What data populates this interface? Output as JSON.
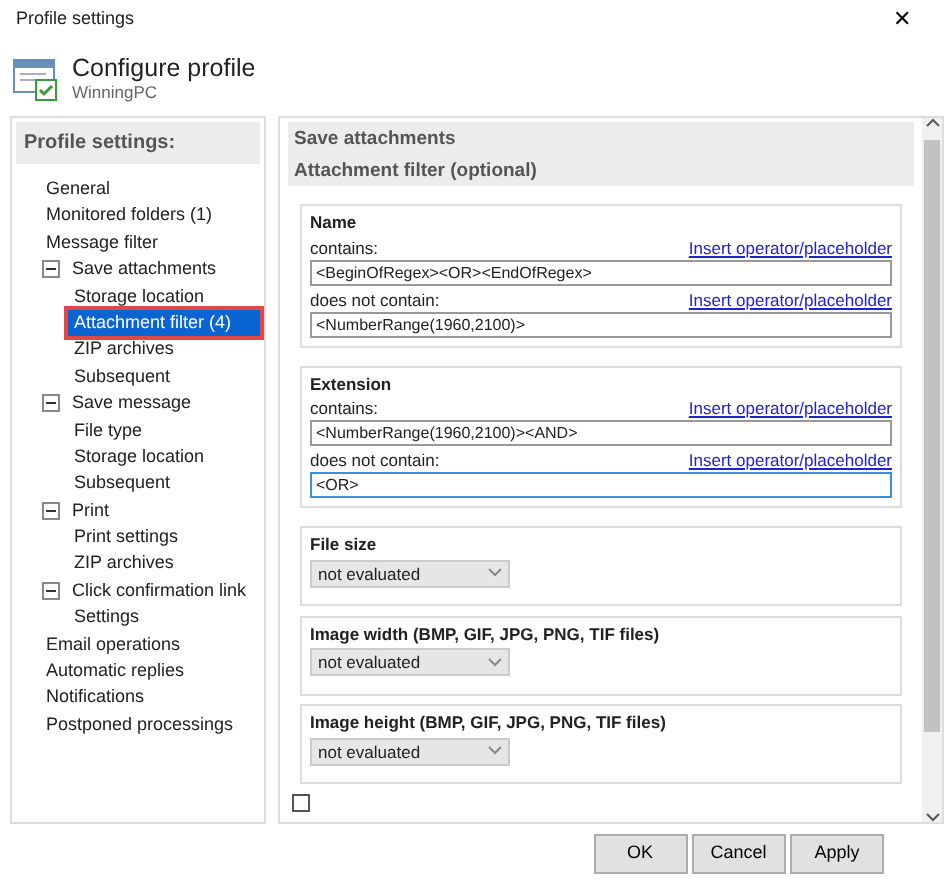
{
  "window": {
    "title": "Profile settings",
    "close": "✕"
  },
  "header": {
    "title": "Configure profile",
    "subtitle": "WinningPC"
  },
  "sidebar": {
    "title": "Profile settings:",
    "items": [
      {
        "label": "General",
        "selected": false
      },
      {
        "label": "Monitored folders (1)",
        "selected": false
      },
      {
        "label": "Message filter",
        "selected": false
      },
      {
        "label": "Save attachments",
        "selected": false,
        "expanded": true,
        "children": [
          {
            "label": "Storage location",
            "selected": false
          },
          {
            "label": "Attachment filter (4)",
            "selected": true
          },
          {
            "label": "ZIP archives",
            "selected": false
          },
          {
            "label": "Subsequent",
            "selected": false
          }
        ]
      },
      {
        "label": "Save message",
        "selected": false,
        "expanded": true,
        "children": [
          {
            "label": "File type",
            "selected": false
          },
          {
            "label": "Storage location",
            "selected": false
          },
          {
            "label": "Subsequent",
            "selected": false
          }
        ]
      },
      {
        "label": "Print",
        "selected": false,
        "expanded": true,
        "children": [
          {
            "label": "Print settings",
            "selected": false
          },
          {
            "label": "ZIP archives",
            "selected": false
          }
        ]
      },
      {
        "label": "Click confirmation link",
        "selected": false,
        "expanded": true,
        "children": [
          {
            "label": "Settings",
            "selected": false
          }
        ]
      },
      {
        "label": "Email operations",
        "selected": false
      },
      {
        "label": "Automatic replies",
        "selected": false
      },
      {
        "label": "Notifications",
        "selected": false
      },
      {
        "label": "Postponed processings",
        "selected": false
      }
    ]
  },
  "content": {
    "section": "Save attachments",
    "subsection": "Attachment filter (optional)",
    "groups": [
      {
        "kind": "text",
        "title": "Name",
        "fields": [
          {
            "label": "contains:",
            "link": "Insert operator/placeholder",
            "value": "<BeginOfRegex><OR><EndOfRegex>",
            "focused": false
          },
          {
            "label": "does not contain:",
            "link": "Insert operator/placeholder",
            "value": "<NumberRange(1960,2100)>",
            "focused": false
          }
        ]
      },
      {
        "kind": "text",
        "title": "Extension",
        "fields": [
          {
            "label": "contains:",
            "link": "Insert operator/placeholder",
            "value": "<NumberRange(1960,2100)><AND>",
            "focused": false
          },
          {
            "label": "does not contain:",
            "link": "Insert operator/placeholder",
            "value": "<OR>",
            "focused": true
          }
        ]
      },
      {
        "kind": "select",
        "title": "File size",
        "value": "not evaluated"
      },
      {
        "kind": "select",
        "title": "Image width (BMP, GIF, JPG, PNG, TIF files)",
        "value": "not evaluated"
      },
      {
        "kind": "select",
        "title": "Image height (BMP, GIF, JPG, PNG, TIF files)",
        "value": "not evaluated"
      }
    ],
    "checkbox": {
      "checked": false
    }
  },
  "buttons": [
    "OK",
    "Cancel",
    "Apply"
  ]
}
